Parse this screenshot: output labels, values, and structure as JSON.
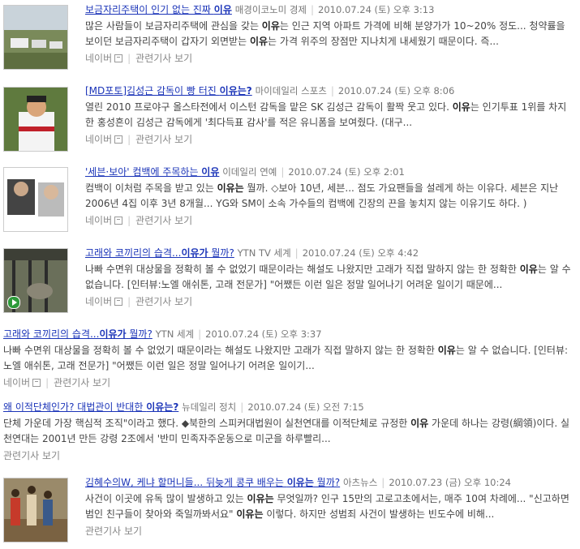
{
  "results": [
    {
      "title_pre": "보금자리주택이 인기 없는 진짜 ",
      "title_bold": "이유",
      "title_post": "",
      "source": "매경이코노미 경제",
      "date": "2010.07.24 (토) 오후 3:13",
      "desc_parts": [
        "많은 사람들이 보금자리주택에 관심을 갖는 ",
        "이유",
        "는 인근 지역 아파트 가격에 비해 분양가가 10~20% 정도... 청약률을 보이던 보금자리주택이 갑자기 외면받는 ",
        "이유",
        "는 가격 위주의 장점만 지나치게 내세웠기 때문이다. 즉..."
      ],
      "link_naver": "네이버",
      "link_related": "관련기사 보기"
    },
    {
      "title_pre": "[MD포토]김성근 감독이 빵 터진 ",
      "title_bold": "이유는?",
      "title_post": "",
      "source": "마이데일리 스포츠",
      "date": "2010.07.24 (토) 오후 8:06",
      "desc_parts": [
        "열린 2010 프로야구 올스타전에서 이스턴 감독을 맡은 SK 김성근 감독이 활짝 웃고 있다. ",
        "이유",
        "는 인기투표 1위를 차지한 홍성흔이 김성근 감독에게 '최다득표 감사'를 적은 유니폼을 보여줬다. (대구..."
      ],
      "link_naver": "네이버",
      "link_related": "관련기사 보기"
    },
    {
      "title_pre": "'세븐·보아' 컴백에 주목하는 ",
      "title_bold": "이유",
      "title_post": "",
      "source": "이데일리 연예",
      "date": "2010.07.24 (토) 오후 2:01",
      "desc_parts": [
        "컴백이 이처럼 주목을 받고 있는 ",
        "이유는",
        " 뭘까. ◇보아 10년, 세븐... 점도 가요팬들을 설레게 하는 이유다. 세븐은 지난 2006년 4집 이후 3년 8개월... YG와 SM이 소속 가수들의 컴백에 긴장의 끈을 놓치지 않는 이유기도 하다. )"
      ],
      "link_naver": "네이버",
      "link_related": "관련기사 보기"
    },
    {
      "title_pre": "고래와 코끼리의 습격...",
      "title_bold": "이유가",
      "title_post": " 뭘까?",
      "source": "YTN TV 세계",
      "date": "2010.07.24 (토) 오후 4:42",
      "desc_parts": [
        "나빠 수면위 대상물을 정확히 볼 수 없었기 때문이라는 해설도 나왔지만 고래가 직접 말하지 않는 한 정확한 ",
        "이유",
        "는 알 수 없습니다. [인터뷰:노엘 애쉬톤, 고래 전문가] \"어쨌든 이런 일은 정말 일어나기 어려운 일이기 때문에..."
      ],
      "link_naver": "네이버",
      "link_related": "관련기사 보기"
    },
    {
      "title_pre": "고래와 코끼리의 습격...",
      "title_bold": "이유가",
      "title_post": " 뭘까?",
      "source": "YTN 세계",
      "date": "2010.07.24 (토) 오후 3:37",
      "desc_parts": [
        "나빠 수면위 대상물을 정확히 볼 수 없었기 때문이라는 해설도 나왔지만 고래가 직접 말하지 않는 한 정확한 ",
        "이유",
        "는 알 수 없습니다. [인터뷰:노엘 애쉬톤, 고래 전문가] \"어쨌든 이런 일은 정말 일어나기 어려운 일이기..."
      ],
      "link_naver": "네이버",
      "link_related": "관련기사 보기"
    },
    {
      "title_pre": "왜 이적단체인가? 대법관이 반대한 ",
      "title_bold": "이유는?",
      "title_post": "",
      "source": "뉴데일리 정치",
      "date": "2010.07.24 (토) 오전 7:15",
      "desc_parts": [
        "단체 가운데 가장 핵심적 조직\"이라고 했다. ◆북한의 스피커대법원이 실천연대를 이적단체로 규정한 ",
        "이유",
        " 가운데 하나는 강령(綱領)이다. 실천연대는 2001년 만든 강령 2조에서 '반미 민족자주운동으로 미군을 하루빨리..."
      ],
      "link_related": "관련기사 보기"
    },
    {
      "title_pre": "김혜수의W, 케냐 할머니들... 뒤늦게 콩쿠 배우는 ",
      "title_bold": "이유는",
      "title_post": " 뭘까?",
      "source": "아츠뉴스",
      "date": "2010.07.23 (금) 오후 10:24",
      "desc_parts": [
        "사건이 이곳에 유독 많이 발생하고 있는 ",
        "이유는",
        " 무엇일까? 인구 15만의 고로고초에서는, 매주 10여 차례에... \"신고하면 범인 친구들이 찾아와 죽일까봐서요\" ",
        "이유는",
        " 이렇다. 하지만 성범죄 사건이 발생하는 빈도수에 비해..."
      ],
      "link_related": "관련기사 보기"
    }
  ]
}
